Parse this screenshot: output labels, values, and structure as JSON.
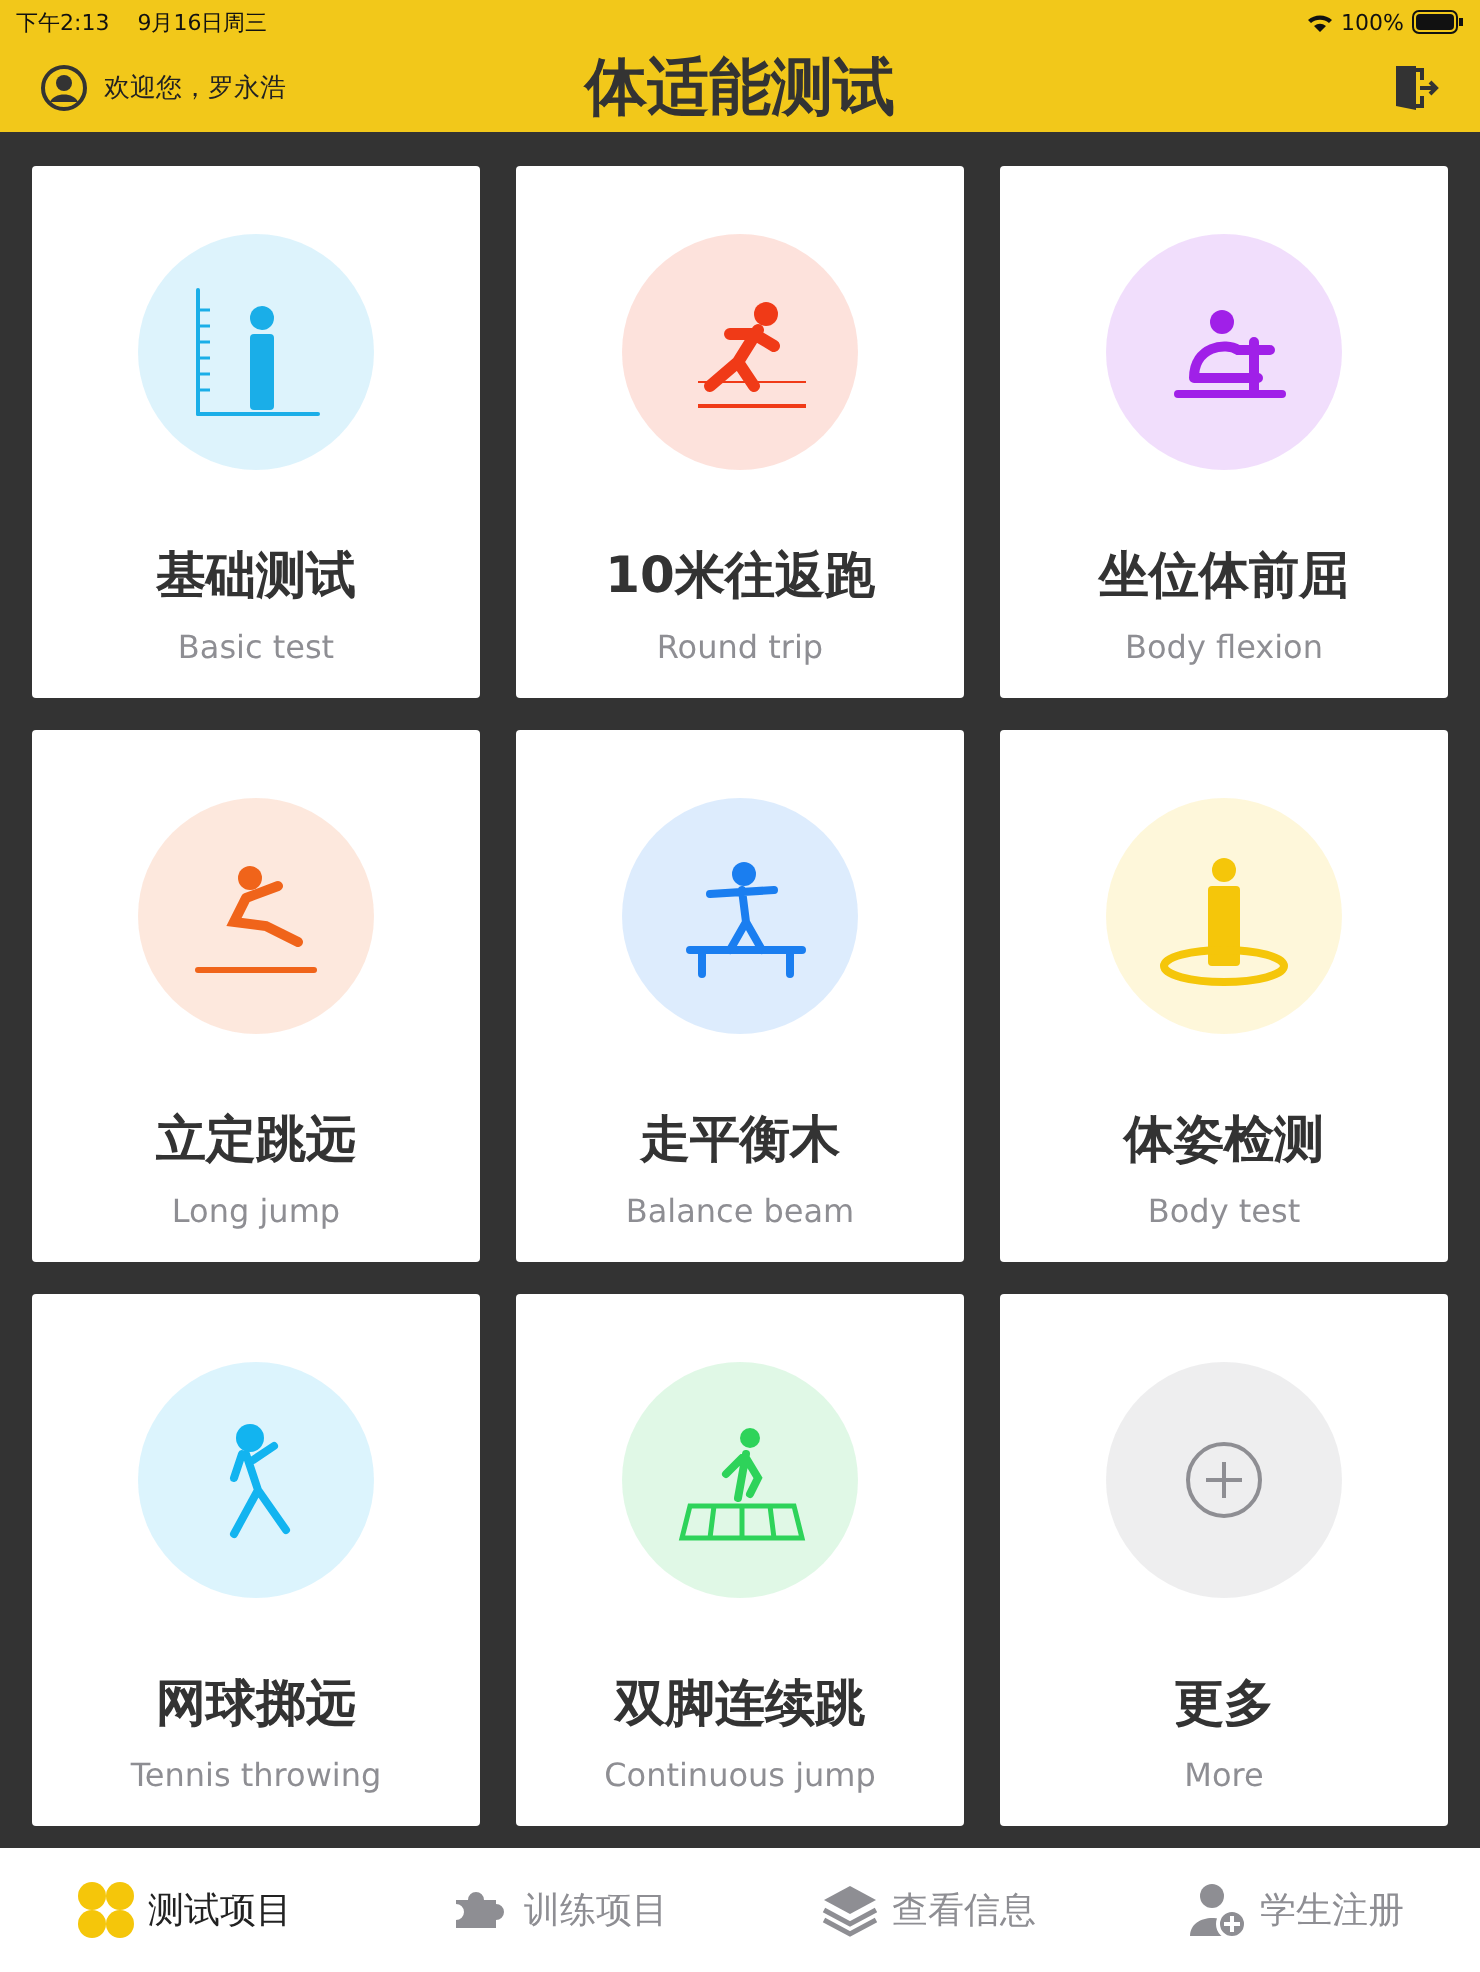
{
  "status_bar": {
    "time": "下午2:13",
    "date": "9月16日周三",
    "battery": "100%"
  },
  "header": {
    "greeting": "欢迎您，罗永浩",
    "title": "体适能测试"
  },
  "cards": [
    {
      "title": "基础测试",
      "subtitle": "Basic test",
      "kind": "height",
      "color": "#1aaee8"
    },
    {
      "title": "10米往返跑",
      "subtitle": "Round trip",
      "kind": "run",
      "color": "#f03a17"
    },
    {
      "title": "坐位体前屈",
      "subtitle": "Body flexion",
      "kind": "flex",
      "color": "#a020e8"
    },
    {
      "title": "立定跳远",
      "subtitle": "Long jump",
      "kind": "jump",
      "color": "#f0641a"
    },
    {
      "title": "走平衡木",
      "subtitle": "Balance beam",
      "kind": "beam",
      "color": "#1a7ef0"
    },
    {
      "title": "体姿检测",
      "subtitle": "Body test",
      "kind": "posture",
      "color": "#f5c60a"
    },
    {
      "title": "网球掷远",
      "subtitle": "Tennis throwing",
      "kind": "throw",
      "color": "#12b4f0"
    },
    {
      "title": "双脚连续跳",
      "subtitle": "Continuous jump",
      "kind": "hop",
      "color": "#2ed35a"
    },
    {
      "title": "更多",
      "subtitle": "More",
      "kind": "more",
      "color": "#8e8e93"
    }
  ],
  "tabs": [
    {
      "label": "测试项目",
      "kind": "grid",
      "selected": true
    },
    {
      "label": "训练项目",
      "kind": "puzzle",
      "selected": false
    },
    {
      "label": "查看信息",
      "kind": "layers",
      "selected": false
    },
    {
      "label": "学生注册",
      "kind": "user",
      "selected": false
    }
  ]
}
